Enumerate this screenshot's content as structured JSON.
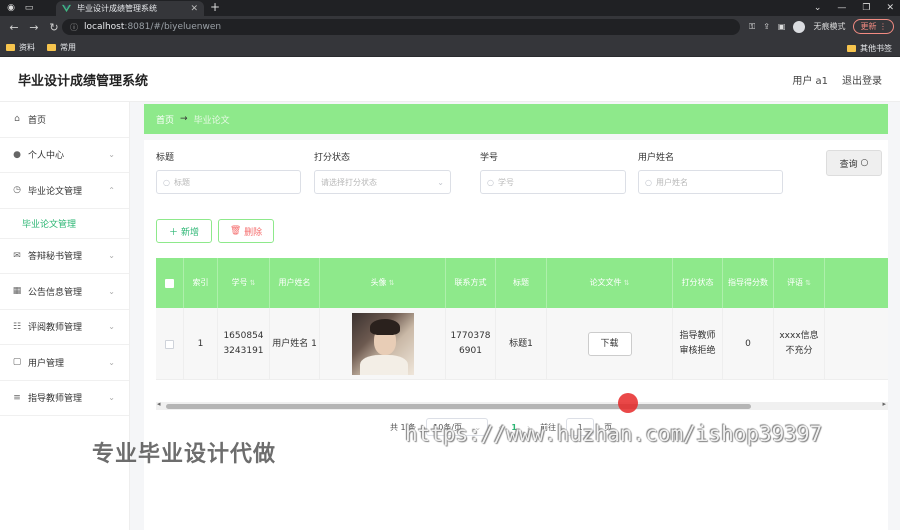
{
  "browser": {
    "tab_title": "毕业设计成绩管理系统",
    "url_host": "localhost",
    "url_rest": ":8081/#/biyeluenwen",
    "incognito_label": "无痕模式",
    "update_label": "更新",
    "bookmarks": [
      "资料",
      "常用"
    ],
    "bookmarks_right": "其他书签"
  },
  "header": {
    "title": "毕业设计成绩管理系统",
    "user": "用户 a1",
    "logout": "退出登录"
  },
  "sidebar": {
    "items": [
      {
        "label": "首页",
        "icon": "home-icon"
      },
      {
        "label": "个人中心",
        "icon": "user-icon"
      },
      {
        "label": "毕业论文管理",
        "icon": "clock-icon"
      },
      {
        "label": "答辩秘书管理",
        "icon": "mail-icon"
      },
      {
        "label": "公告信息管理",
        "icon": "grid-icon"
      },
      {
        "label": "评阅教师管理",
        "icon": "list-icon"
      },
      {
        "label": "用户管理",
        "icon": "chat-icon"
      },
      {
        "label": "指导教师管理",
        "icon": "menu-icon"
      }
    ],
    "sub_item": "毕业论文管理"
  },
  "breadcrumb": {
    "home": "首页",
    "current": "毕业论文"
  },
  "search": {
    "title_label": "标题",
    "title_placeholder": "标题",
    "status_label": "打分状态",
    "status_placeholder": "请选择打分状态",
    "id_label": "学号",
    "id_placeholder": "学号",
    "name_label": "用户姓名",
    "name_placeholder": "用户姓名",
    "query_label": "查询"
  },
  "actions": {
    "add": "新增",
    "delete": "删除"
  },
  "table": {
    "headers": [
      "索引",
      "学号",
      "用户姓名",
      "头像",
      "联系方式",
      "标题",
      "论文文件",
      "打分状态",
      "指导得分数",
      "评语"
    ],
    "rows": [
      {
        "index": "1",
        "student_id": "1650854 3243191",
        "name": "用户姓名 1",
        "phone": "1770378 6901",
        "title": "标题1",
        "file_btn": "下载",
        "status": "指导教师 审核拒绝",
        "score": "0",
        "comment": "xxxx信息 不充分"
      }
    ]
  },
  "pager": {
    "total": "共 1 条",
    "page_size": "10条/页",
    "current_page": "1",
    "goto_label": "前往",
    "goto_value": "1",
    "page_suffix": "页"
  },
  "watermarks": {
    "cn": "专业毕业设计代做",
    "url": "https://www.huzhan.com/ishop39397"
  }
}
